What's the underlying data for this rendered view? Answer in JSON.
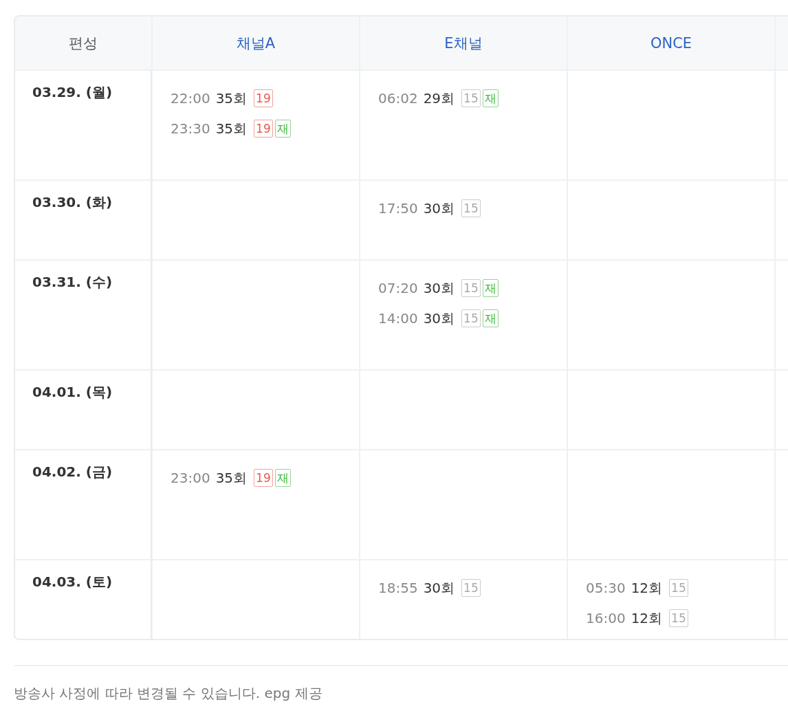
{
  "table": {
    "corner": "편성",
    "columns": [
      {
        "label": "채널A",
        "kind": "channel"
      },
      {
        "label": "E채널",
        "kind": "channel"
      },
      {
        "label": "ONCE",
        "kind": "channel"
      }
    ],
    "rows": [
      {
        "date": "03.29. (월)",
        "cells": [
          [
            {
              "time": "22:00",
              "episode": "35회",
              "badges": [
                {
                  "text": "19",
                  "kind": "adult"
                }
              ]
            },
            {
              "time": "23:30",
              "episode": "35회",
              "badges": [
                {
                  "text": "19",
                  "kind": "adult"
                },
                {
                  "text": "재",
                  "kind": "rerun"
                }
              ]
            }
          ],
          [
            {
              "time": "06:02",
              "episode": "29회",
              "badges": [
                {
                  "text": "15",
                  "kind": "teen"
                },
                {
                  "text": "재",
                  "kind": "rerun"
                }
              ]
            }
          ],
          []
        ]
      },
      {
        "date": "03.30. (화)",
        "cells": [
          [],
          [
            {
              "time": "17:50",
              "episode": "30회",
              "badges": [
                {
                  "text": "15",
                  "kind": "teen"
                }
              ]
            }
          ],
          []
        ]
      },
      {
        "date": "03.31. (수)",
        "cells": [
          [],
          [
            {
              "time": "07:20",
              "episode": "30회",
              "badges": [
                {
                  "text": "15",
                  "kind": "teen"
                },
                {
                  "text": "재",
                  "kind": "rerun"
                }
              ]
            },
            {
              "time": "14:00",
              "episode": "30회",
              "badges": [
                {
                  "text": "15",
                  "kind": "teen"
                },
                {
                  "text": "재",
                  "kind": "rerun"
                }
              ]
            }
          ],
          []
        ]
      },
      {
        "date": "04.01. (목)",
        "cells": [
          [],
          [],
          []
        ]
      },
      {
        "date": "04.02. (금)",
        "cells": [
          [
            {
              "time": "23:00",
              "episode": "35회",
              "badges": [
                {
                  "text": "19",
                  "kind": "adult"
                },
                {
                  "text": "재",
                  "kind": "rerun"
                }
              ]
            }
          ],
          [],
          []
        ]
      },
      {
        "date": "04.03. (토)",
        "cells": [
          [],
          [
            {
              "time": "18:55",
              "episode": "30회",
              "badges": [
                {
                  "text": "15",
                  "kind": "teen"
                }
              ]
            }
          ],
          [
            {
              "time": "05:30",
              "episode": "12회",
              "badges": [
                {
                  "text": "15",
                  "kind": "teen"
                }
              ]
            },
            {
              "time": "16:00",
              "episode": "12회",
              "badges": [
                {
                  "text": "15",
                  "kind": "teen"
                }
              ]
            }
          ]
        ]
      }
    ]
  },
  "footer": {
    "note": "방송사 사정에 따라 변경될 수 있습니다. epg 제공"
  }
}
